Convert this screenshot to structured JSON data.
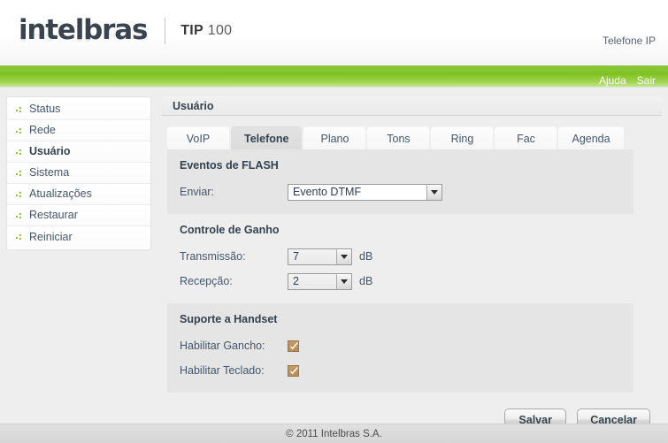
{
  "header": {
    "logo_text": "intelbras",
    "model_prefix": "TIP",
    "model_number": "100",
    "device_type": "Telefone IP"
  },
  "topbar": {
    "help_label": "Ajuda",
    "logout_label": "Sair"
  },
  "sidebar": {
    "items": [
      {
        "label": "Status",
        "active": false
      },
      {
        "label": "Rede",
        "active": false
      },
      {
        "label": "Usuário",
        "active": true
      },
      {
        "label": "Sistema",
        "active": false
      },
      {
        "label": "Atualizações",
        "active": false
      },
      {
        "label": "Restaurar",
        "active": false
      },
      {
        "label": "Reiniciar",
        "active": false
      }
    ]
  },
  "main": {
    "panel_title": "Usuário",
    "tabs": [
      {
        "label": "VoIP",
        "active": false
      },
      {
        "label": "Telefone",
        "active": true
      },
      {
        "label": "Plano",
        "active": false
      },
      {
        "label": "Tons",
        "active": false
      },
      {
        "label": "Ring",
        "active": false
      },
      {
        "label": "Fac",
        "active": false
      },
      {
        "label": "Agenda",
        "active": false
      }
    ],
    "flash_section": {
      "heading": "Eventos de FLASH",
      "enviar_label": "Enviar:",
      "enviar_value": "Evento DTMF"
    },
    "gain_section": {
      "heading": "Controle de Ganho",
      "transmissao_label": "Transmissão:",
      "transmissao_value": "7",
      "transmissao_unit": "dB",
      "recepcao_label": "Recepção:",
      "recepcao_value": "2",
      "recepcao_unit": "dB"
    },
    "handset_section": {
      "heading": "Suporte a Handset",
      "gancho_label": "Habilitar Gancho:",
      "gancho_checked": true,
      "teclado_label": "Habilitar Teclado:",
      "teclado_checked": true
    },
    "actions": {
      "save_label": "Salvar",
      "cancel_label": "Cancelar"
    }
  },
  "footer": {
    "copyright": "© 2011 Intelbras S.A."
  },
  "colors": {
    "accent_green": "#8cc63e",
    "text_blue": "#44566b",
    "checkbox_tan": "#c69a63"
  }
}
